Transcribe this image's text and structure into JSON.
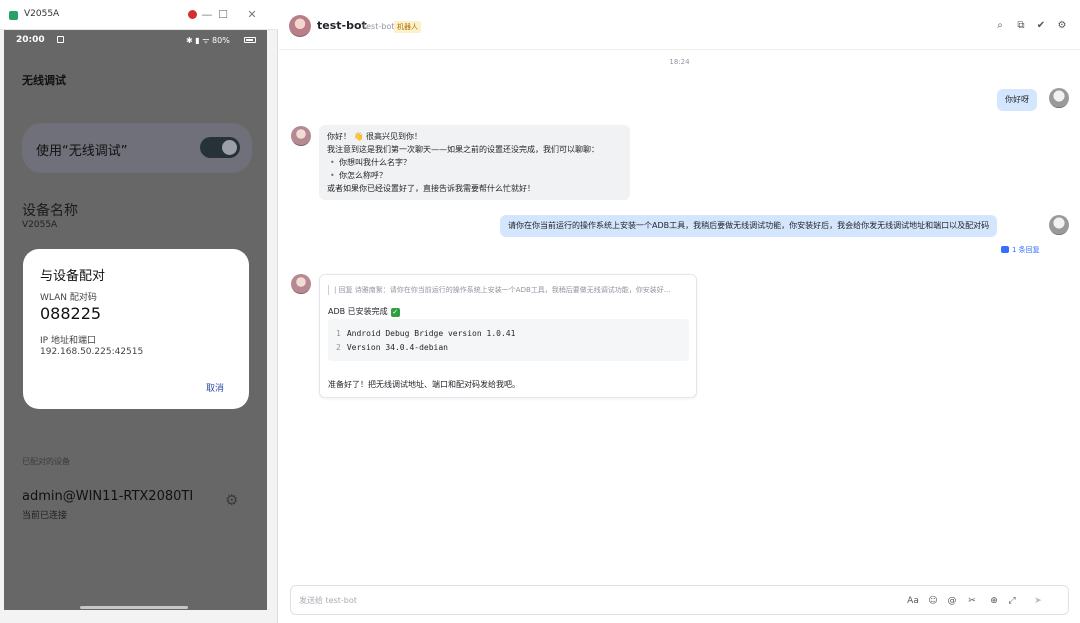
{
  "window": {
    "title": "V2055A",
    "controls": {
      "minimize": "—",
      "maximize": "☐",
      "close": "✕"
    }
  },
  "phone": {
    "status_time": "20:00",
    "status_icons": "✱ ▮ ᯤ 80%",
    "screen_title": "无线调试",
    "toggle_label": "使用“无线调试”",
    "toggle_on": true,
    "device_name_label": "设备名称",
    "device_name_value": "V2055A",
    "dialog": {
      "title": "与设备配对",
      "code_label": "WLAN 配对码",
      "code": "088225",
      "ip_label": "IP 地址和端口",
      "ip": "192.168.50.225:42515",
      "cancel": "取消"
    },
    "paired_label": "已配对的设备",
    "paired_device": "admin@WIN11-RTX2080TI",
    "paired_status": "当前已连接",
    "gear_glyph": "⚙"
  },
  "chat": {
    "header": {
      "name": "test-bot",
      "handle": "test-bot",
      "badge": "机器人",
      "tools": [
        "⌕",
        "⧉",
        "✔",
        "⚙"
      ]
    },
    "timestamp": "18:24",
    "messages": {
      "m1": {
        "text": "你好呀"
      },
      "m2": {
        "greeting": "你好！ 👋 很高兴见到你！",
        "line1": "我注意到这是我们第一次聊天——如果之前的设置还没完成，我们可以聊聊：",
        "bullets": [
          "你想叫我什么名字？",
          "你怎么称呼？"
        ],
        "line2": "或者如果你已经设置好了，直接告诉我需要帮什么忙就好！"
      },
      "m3": {
        "text": "请你在你当前运行的操作系统上安装一个ADB工具，我稍后要做无线调试功能，你安装好后，我会给你发无线调试地址和端口以及配对码"
      },
      "reply_count": "1 条回复",
      "m4": {
        "quote": "| 回复 诗雅南絮：请你在你当前运行的操作系统上安装一个ADB工具，我稍后要做无线调试功能，你安装好...",
        "status": "ADB 已安装完成",
        "code_lines": [
          {
            "num": "1",
            "text": "Android Debug Bridge version 1.0.41"
          },
          {
            "num": "2",
            "text": "Version 34.0.4-debian"
          }
        ],
        "closing": "准备好了！把无线调试地址、端口和配对码发给我吧。"
      }
    },
    "input": {
      "placeholder": "发送给 test-bot",
      "tools": [
        "Aa",
        "☺",
        "@",
        "✂",
        "⊕",
        "⤢",
        "➤"
      ]
    }
  }
}
